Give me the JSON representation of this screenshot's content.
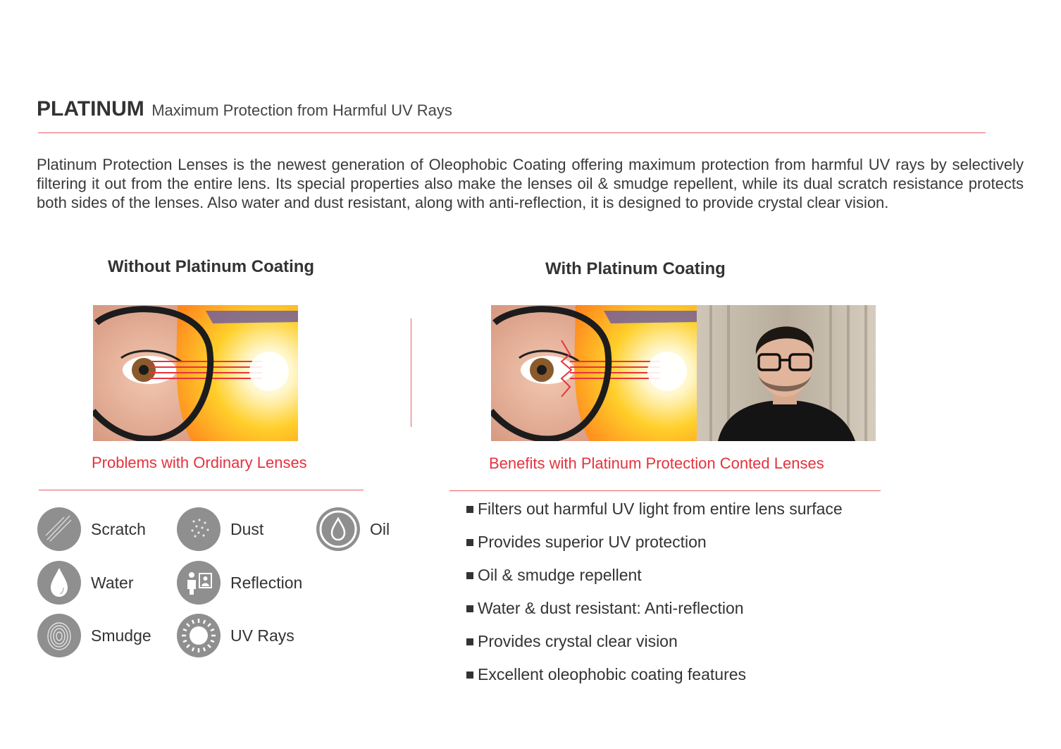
{
  "header": {
    "brand": "PLATINUM",
    "tagline": "Maximum Protection from Harmful UV Rays"
  },
  "intro": "Platinum Protection Lenses is the newest generation of Oleophobic Coating offering maximum protection from harmful UV rays by selectively filtering it out from the entire lens. Its special properties also make the lenses oil & smudge repellent, while its dual scratch resistance protects both sides of the lenses. Also water and dust resistant, along with anti-reflection, it is designed to provide crystal clear vision.",
  "without": {
    "heading": "Without Platinum Coating",
    "caption": "Problems with Ordinary Lenses",
    "problems": [
      {
        "label": "Scratch",
        "icon": "scratch-icon"
      },
      {
        "label": "Dust",
        "icon": "dust-icon"
      },
      {
        "label": "Oil",
        "icon": "oil-drop-icon"
      },
      {
        "label": "Water",
        "icon": "water-drop-icon"
      },
      {
        "label": "Reflection",
        "icon": "reflection-icon"
      },
      {
        "label": "Smudge",
        "icon": "fingerprint-icon"
      },
      {
        "label": "UV Rays",
        "icon": "sun-icon"
      }
    ]
  },
  "with": {
    "heading": "With Platinum Coating",
    "caption": "Benefits with Platinum Protection Conted Lenses",
    "benefits": [
      "Filters out harmful UV light from entire lens surface",
      "Provides superior UV protection",
      "Oil & smudge repellent",
      "Water & dust resistant: Anti-reflection",
      "Provides crystal clear vision",
      "Excellent oleophobic coating features"
    ]
  },
  "colors": {
    "accent": "#e5323d",
    "rule": "#e8606a",
    "icon_bg": "#8f8f90",
    "text": "#333333"
  }
}
